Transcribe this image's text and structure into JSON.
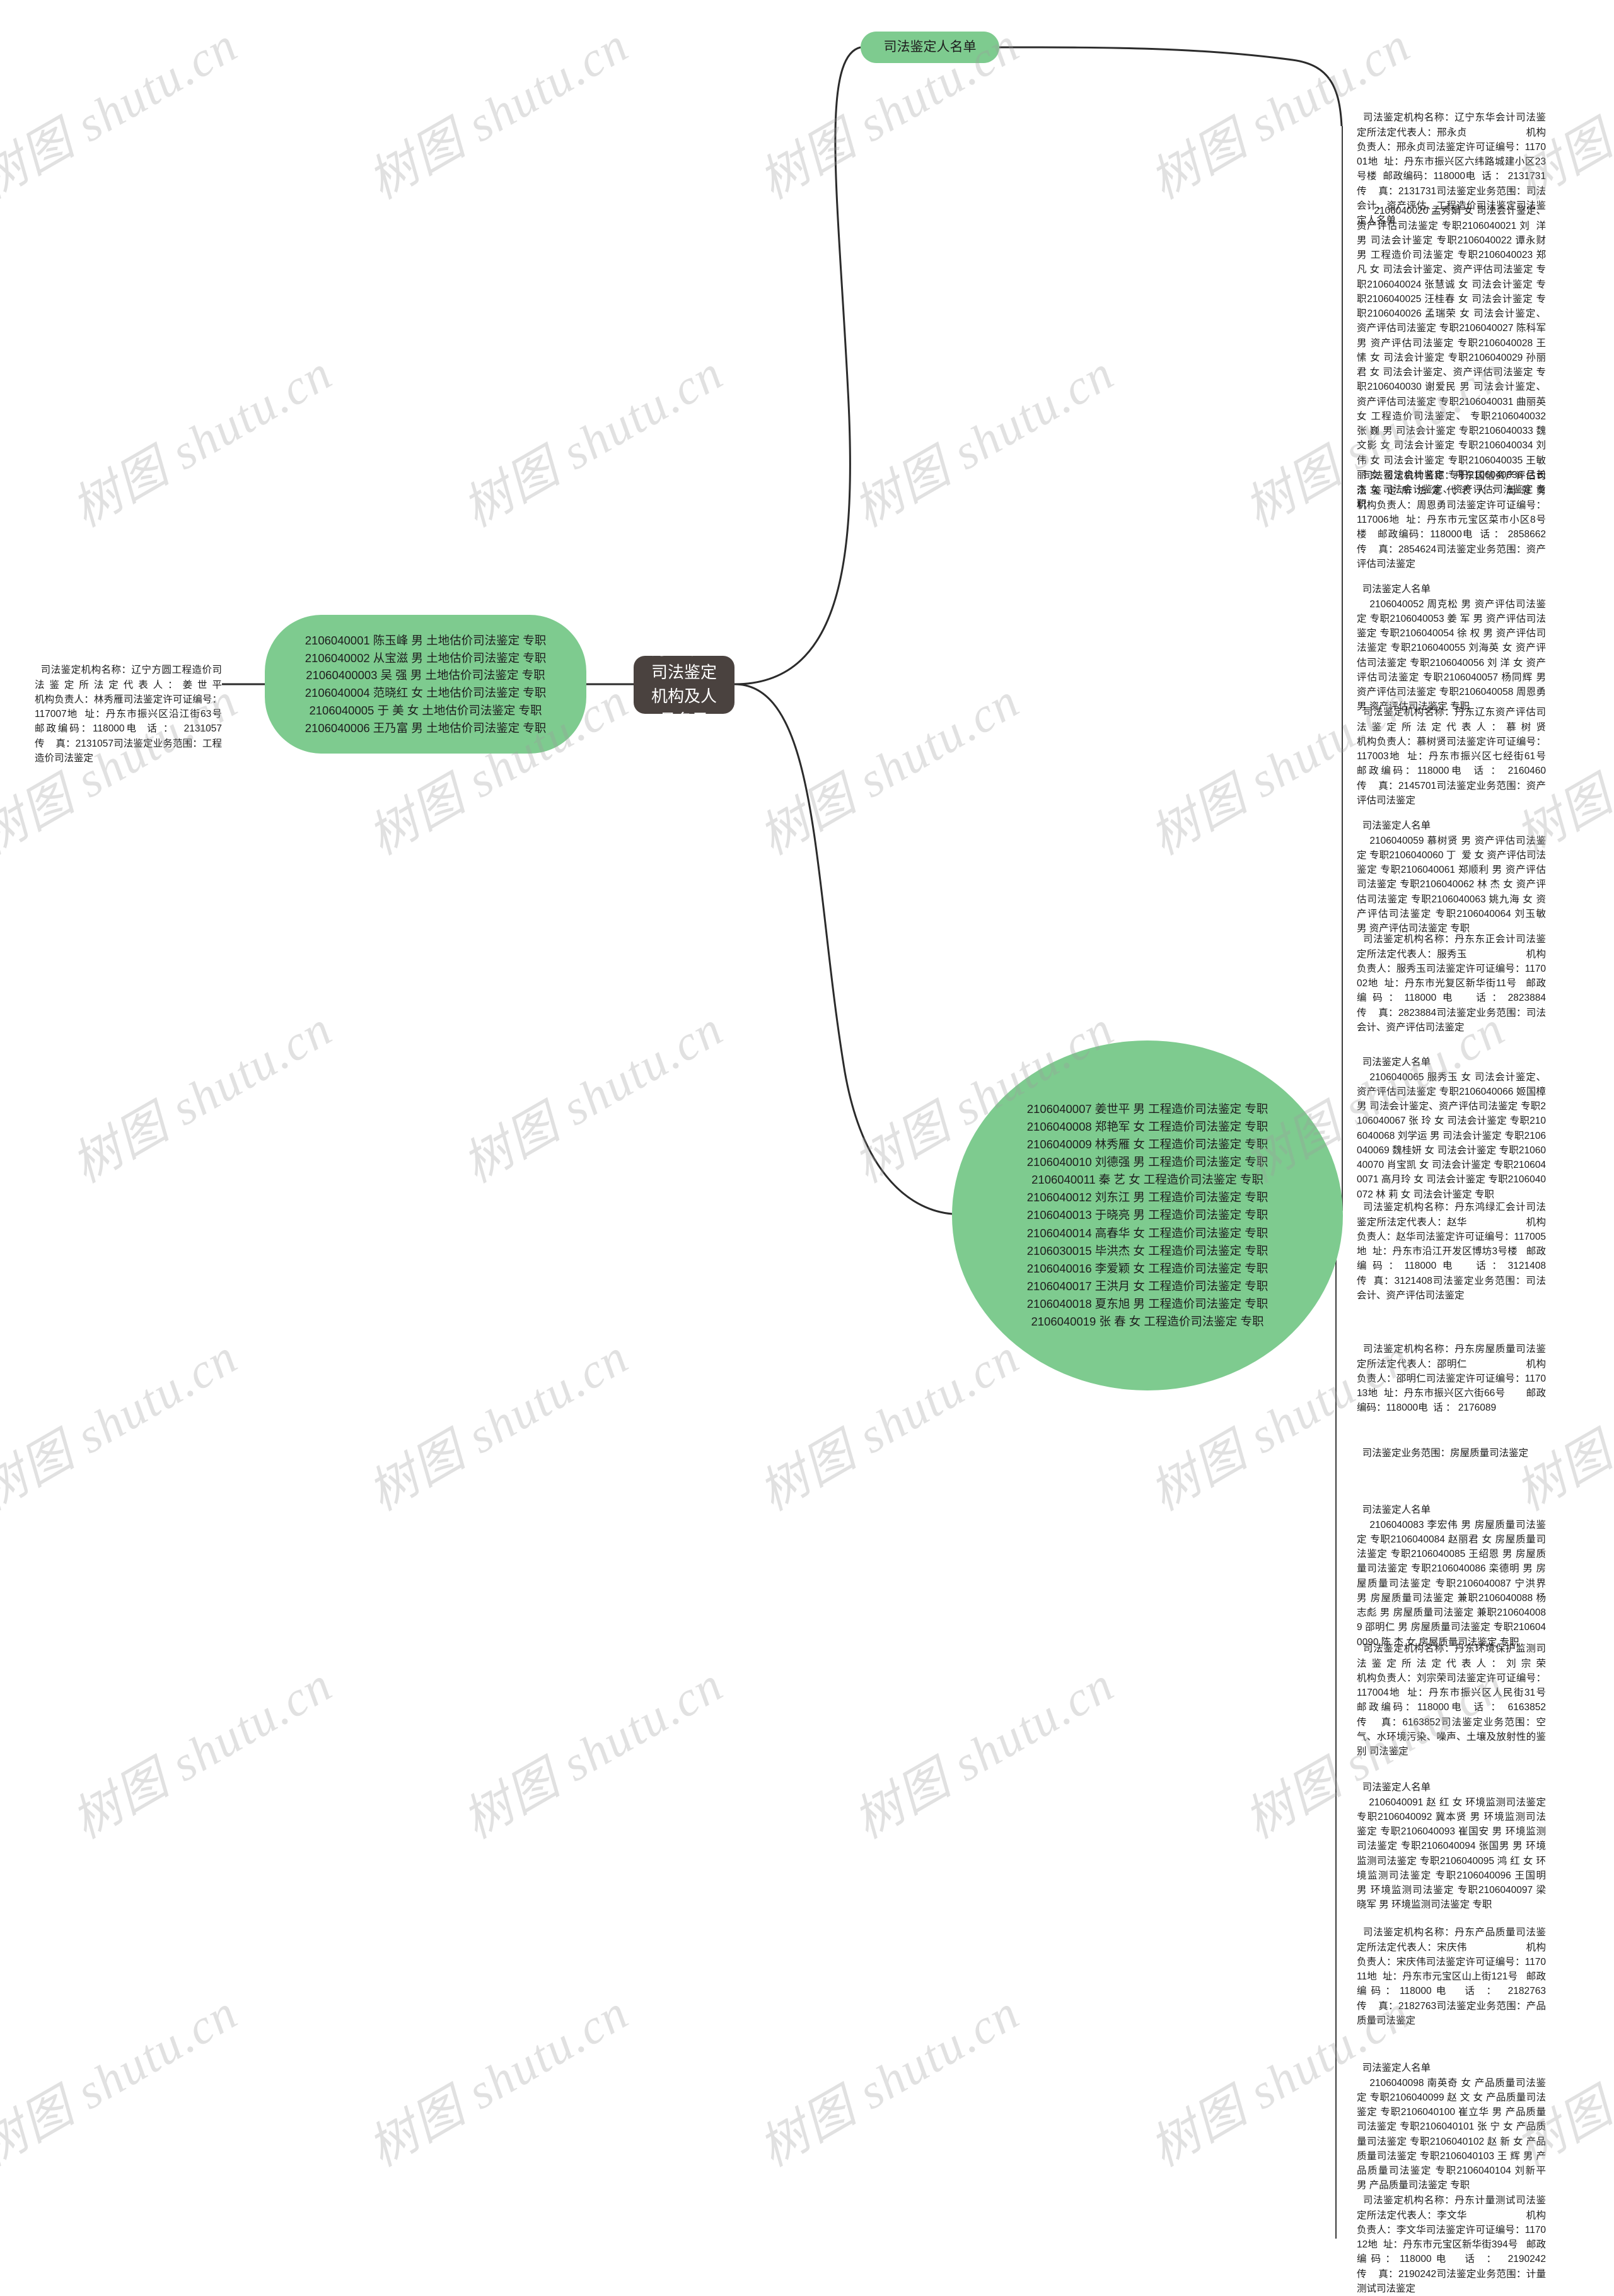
{
  "meta": {
    "title": "丹东市：司法鉴定机构及人员名录",
    "watermark": "树图 shutu.cn",
    "accent_green": "#7ecb8f",
    "root_color": "#4a423f"
  },
  "root": {
    "label": "丹东市：司法鉴定机构及人员名录"
  },
  "branches": {
    "top_pill": {
      "label": "司法鉴定人名单"
    },
    "left_org": {
      "label": "司法鉴定机构名称：辽宁方圆工程造价司法鉴定所法定代表人：姜世平                    机构负责人：林秀雁司法鉴定许可证编号：117007地  址：丹东市振兴区沿江街63号   邮政编码：118000电  话 ：  2131057                    传    真：2131057司法鉴定业务范围：工程造价司法鉴定"
    },
    "left_people": {
      "label": "2106040001 陈玉峰 男 土地估价司法鉴定 专职2106040002 从宝滋 男 土地估价司法鉴定 专职21060400003 吴  强 男 土地估价司法鉴定 专职2106040004 范晓红 女 土地估价司法鉴定 专职2106040005 于  美 女 土地估价司法鉴定 专职2106040006 王乃富 男 土地估价司法鉴定 专职"
    },
    "right_people": {
      "label": "2106040007 姜世平 男 工程造价司法鉴定 专职2106040008 郑艳军 女 工程造价司法鉴定 专职2106040009 林秀雁 女 工程造价司法鉴定 专职2106040010 刘德强 男 工程造价司法鉴定 专职2106040011 秦  艺 女 工程造价司法鉴定 专职2106040012 刘东江 男 工程造价司法鉴定 专职2106040013 于晓亮 男 工程造价司法鉴定 专职2106040014 高春华 女 工程造价司法鉴定 专职2106030015 毕洪杰 女 工程造价司法鉴定 专职2106040016 李爱颖 女 工程造价司法鉴定 专职2106040017 王洪月 女 工程造价司法鉴定 专职2106040018 夏东旭 男 工程造价司法鉴定 专职2106040019 张   春 女 工程造价司法鉴定 专职"
    }
  },
  "right_column": [
    {
      "id": "org-donghua",
      "type": "org",
      "text": "司法鉴定机构名称：辽宁东华会计司法鉴定所法定代表人：邢永贞                    机构负责人：邢永贞司法鉴定许可证编号：117001地  址：丹东市振兴区六纬路城建小区23号楼  邮政编码：118000电  话 ： 2131731                    传    真：2131731司法鉴定业务范围：司法会计、资产评估、工程造价司法鉴定司法鉴定人名单"
    },
    {
      "id": "people-donghua",
      "type": "people",
      "text": "    2106040020 孟秀娟 女 司法会计鉴定、资产评估司法鉴定 专职2106040021 刘  洋 男 司法会计鉴定 专职2106040022 谭永财 男 工程造价司法鉴定 专职2106040023 郑凡 女 司法会计鉴定、资产评估司法鉴定 专职2106040024 张慧诚 女 司法会计鉴定 专职2106040025 汪桂春 女 司法会计鉴定 专职2106040026 孟瑞荣 女 司法会计鉴定、资产评估司法鉴定 专职2106040027 陈科军 男 资产评估司法鉴定 专职2106040028 王 愫 女 司法会计鉴定 专职2106040029 孙丽君 女 司法会计鉴定、资产评估司法鉴定 专职2106040030 谢爱民 男 司法会计鉴定、资产评估司法鉴定 专职2106040031 曲丽英 女 工程造价司法鉴定、 专职2106040032 张 巍 男 司法会计鉴定 专职2106040033 魏文影 女 司法会计鉴定 专职2106040034 刘 伟 女 司法会计鉴定 专职2106040035 王敏丽 女 司法会计鉴定 专职2106040036 吕长杰 女 司法会计鉴定、资产评估司法鉴定 专职"
    },
    {
      "id": "org-guoxin",
      "type": "org",
      "text": "司法鉴定机构名称：丹东国信资产评估司法鉴定所法定代表人：周恩勇                    机构负责人：周恩勇司法鉴定许可证编号：117006地  址：丹东市元宝区菜市小区8号楼   邮政编码：118000电  话 ： 2858662                    传    真：2854624司法鉴定业务范围：资产评估司法鉴定"
    },
    {
      "id": "people-guoxin",
      "type": "people",
      "text": "司法鉴定人名单\n    2106040052 周克松 男 资产评估司法鉴定 专职2106040053 姜 军 男 资产评估司法鉴定 专职2106040054 徐 权 男 资产评估司法鉴定 专职2106040055 刘海英 女 资产评估司法鉴定 专职2106040056 刘 洋 女 资产评估司法鉴定 专职2106040057 杨同辉 男 资产评估司法鉴定 专职2106040058 周恩勇 男 资产评估司法鉴定 专职"
    },
    {
      "id": "org-liaodong",
      "type": "org",
      "text": "司法鉴定机构名称：丹东辽东资产评估司法鉴定所法定代表人：慕树贤                    机构负责人：慕树贤司法鉴定许可证编号：117003地  址：丹东市振兴区七经街61号  邮政编码：118000电  话 ： 2160460                    传    真：2145701司法鉴定业务范围：资产评估司法鉴定"
    },
    {
      "id": "people-liaodong",
      "type": "people",
      "text": "司法鉴定人名单\n    2106040059 慕树贤 男 资产评估司法鉴定 专职2106040060 丁  爱 女 资产评估司法鉴定 专职2106040061 郑顺利 男 资产评估司法鉴定 专职2106040062 林 杰 女 资产评估司法鉴定 专职2106040063 姚九海 女 资产评估司法鉴定 专职2106040064 刘玉敏 男 资产评估司法鉴定 专职"
    },
    {
      "id": "org-zhengfa",
      "type": "org",
      "text": "司法鉴定机构名称：丹东东正会计司法鉴定所法定代表人：服秀玉                    机构负责人：服秀玉司法鉴定许可证编号：117002地  址：丹东市光复区新华街11号   邮政编码：118000电  话：2823884                    传    真：2823884司法鉴定业务范围：司法会计、资产评估司法鉴定"
    },
    {
      "id": "people-zhengfa",
      "type": "people",
      "text": "司法鉴定人名单\n    2106040065 服秀玉 女 司法会计鉴定、资产评估司法鉴定 专职2106040066 姬国樟 男 司法会计鉴定、资产评估司法鉴定 专职2106040067 张 玲 女 司法会计鉴定 专职2106040068 刘学运 男 司法会计鉴定 专职2106040069 魏桂妍 女 司法会计鉴定 专职2106040070 肖宝凯 女 司法会计鉴定 专职2106040071 高月玲 女 司法会计鉴定 专职2106040072 林 莉 女 司法会计鉴定 专职"
    },
    {
      "id": "org-kuaiji",
      "type": "org",
      "text": "司法鉴定机构名称：丹东鸿绿汇会计司法鉴定所法定代表人：赵华                    机构负责人：赵华司法鉴定许可证编号：117005地  址：丹东市沿江开发区博坊3号楼   邮政编码：118000电  话：3121408                    传  真：3121408司法鉴定业务范围：司法会计、资产评估司法鉴定"
    },
    {
      "id": "org-fangwu",
      "type": "org",
      "text": "司法鉴定机构名称：丹东房屋质量司法鉴定所法定代表人：邵明仁                    机构负责人：邵明仁司法鉴定许可证编号：117013地  址：丹东市振兴区六街66号       邮政编码：118000电  话 ： 2176089"
    },
    {
      "id": "scope-fangwu",
      "type": "scope",
      "text": "司法鉴定业务范围：房屋质量司法鉴定"
    },
    {
      "id": "people-fangwu",
      "type": "people",
      "text": "司法鉴定人名单\n    2106040083 李宏伟 男 房屋质量司法鉴定 专职2106040084 赵丽君 女 房屋质量司法鉴定 专职2106040085 王绍恩 男 房屋质量司法鉴定 专职2106040086 栾德明 男 房屋质量司法鉴定 专职2106040087 宁洪界 男 房屋质量司法鉴定 兼职2106040088 杨志彪 男 房屋质量司法鉴定 兼职2106040089 邵明仁 男 房屋质量司法鉴定 专职2106040090 陈 杰 女 房屋质量司法鉴定 专职"
    },
    {
      "id": "org-huanjing",
      "type": "org",
      "text": "司法鉴定机构名称：丹东环境保护监测司法鉴定所法定代表人：刘宗荣                    机构负责人：刘宗荣司法鉴定许可证编号：117004地  址：丹东市振兴区人民街31号   邮政编码：118000电  话 ： 6163852                    传    真：6163852司法鉴定业务范围：空气、水环境污染、噪声、土壤及放射性的鉴别 司法鉴定"
    },
    {
      "id": "people-huanjing",
      "type": "people",
      "text": "司法鉴定人名单\n    2106040091 赵 红 女 环境监测司法鉴定 专职2106040092 冀本贤 男 环境监测司法鉴定 专职2106040093 崔国安 男 环境监测司法鉴定 专职2106040094 张国男 男 环境监测司法鉴定 专职2106040095 鸿 红 女 环境监测司法鉴定 专职2106040096 王国明 男 环境监测司法鉴定 专职2106040097 梁晓军 男 环境监测司法鉴定 专职"
    },
    {
      "id": "org-chanpin",
      "type": "org",
      "text": "司法鉴定机构名称：丹东产品质量司法鉴定所法定代表人：宋庆伟                    机构负责人：宋庆伟司法鉴定许可证编号：117011地  址：丹东市元宝区山上街121号   邮政编码：118000电  话 ： 2182763                    传    真：2182763司法鉴定业务范围：产品质量司法鉴定"
    },
    {
      "id": "people-chanpin",
      "type": "people",
      "text": "司法鉴定人名单\n    2106040098 南英奇 女 产品质量司法鉴定 专职2106040099 赵 文 女 产品质量司法鉴定 专职2106040100 崔立华 男 产品质量司法鉴定 专职2106040101 张 宁 女 产品质量司法鉴定 专职2106040102 赵 新 女 产品质量司法鉴定 专职2106040103 王 辉 男 产品质量司法鉴定 专职2106040104 刘新平 男 产品质量司法鉴定 专职"
    },
    {
      "id": "org-jiliang",
      "type": "org",
      "text": "司法鉴定机构名称：丹东计量测试司法鉴定所法定代表人：李文华                    机构负责人：李文华司法鉴定许可证编号：117012地  址：丹东市元宝区新华街394号   邮政编码：118000电  话 ： 2190242                    传    真：2190242司法鉴定业务范围：计量测试司法鉴定"
    }
  ]
}
